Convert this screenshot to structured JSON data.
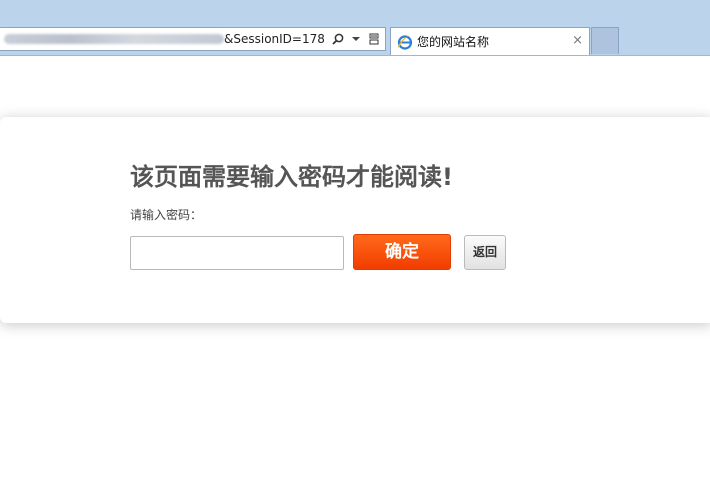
{
  "browser": {
    "address_bar": {
      "url_visible": "&SessionID=178"
    },
    "tab": {
      "title": "您的网站名称",
      "close_glyph": "×"
    },
    "icons": {
      "search": "search-icon",
      "dropdown": "chevron-down-icon",
      "compat": "compatibility-view-icon",
      "refresh": "refresh-icon",
      "favicon": "ie-logo-icon"
    }
  },
  "page": {
    "heading": "该页面需要输入密码才能阅读!",
    "password_label": "请输入密码：",
    "password_value": "",
    "confirm_label": "确定",
    "back_label": "返回"
  },
  "colors": {
    "accent": "#f23c00",
    "chrome": "#bcd3ec",
    "heading": "#555555"
  }
}
